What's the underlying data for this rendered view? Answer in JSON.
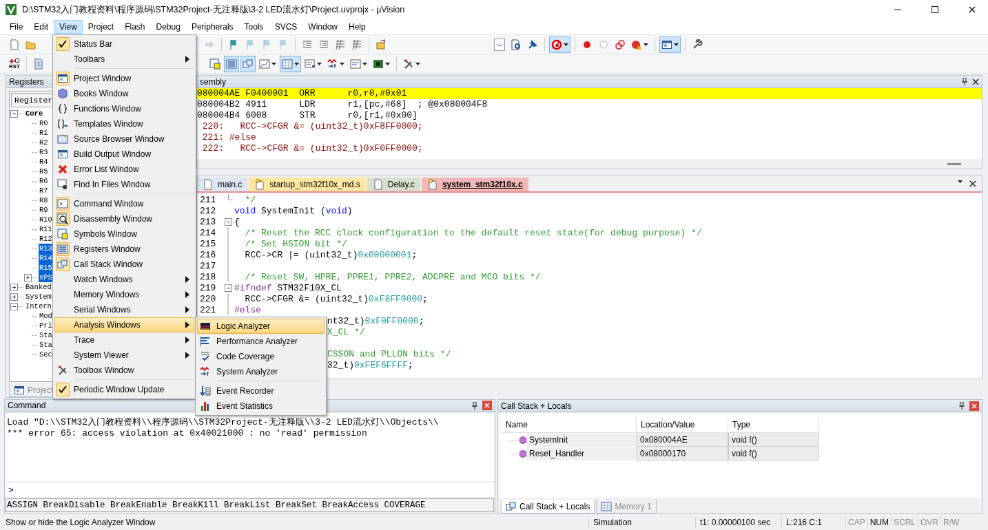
{
  "window": {
    "title": "D:\\STM32入门教程资料\\程序源码\\STM32Project-无注释版\\3-2 LED流水灯\\Project.uvprojx - µVision"
  },
  "menu_bar": [
    {
      "label": "File",
      "selected": false
    },
    {
      "label": "Edit",
      "selected": false
    },
    {
      "label": "View",
      "selected": true
    },
    {
      "label": "Project",
      "selected": false
    },
    {
      "label": "Flash",
      "selected": false
    },
    {
      "label": "Debug",
      "selected": false
    },
    {
      "label": "Peripherals",
      "selected": false
    },
    {
      "label": "Tools",
      "selected": false
    },
    {
      "label": "SVCS",
      "selected": false
    },
    {
      "label": "Window",
      "selected": false
    },
    {
      "label": "Help",
      "selected": false
    }
  ],
  "toolbar_1": {
    "left": [
      {
        "kind": "button",
        "pressed": false,
        "disabled": false,
        "dropdown": false
      },
      {
        "kind": "button",
        "pressed": false,
        "disabled": false,
        "dropdown": false
      }
    ],
    "main": [
      {
        "kind": "button",
        "pressed": false,
        "disabled": true,
        "dropdown": false
      },
      {
        "kind": "separator"
      },
      {
        "kind": "button",
        "pressed": false,
        "disabled": false,
        "dropdown": false
      },
      {
        "kind": "button",
        "pressed": false,
        "disabled": true,
        "dropdown": false
      },
      {
        "kind": "button",
        "pressed": false,
        "disabled": true,
        "dropdown": false
      },
      {
        "kind": "button",
        "pressed": false,
        "disabled": true,
        "dropdown": false
      },
      {
        "kind": "separator"
      },
      {
        "kind": "button",
        "pressed": false,
        "disabled": false,
        "dropdown": false
      },
      {
        "kind": "button",
        "pressed": false,
        "disabled": false,
        "dropdown": false
      },
      {
        "kind": "button",
        "pressed": false,
        "disabled": false,
        "dropdown": false
      },
      {
        "kind": "button",
        "pressed": false,
        "disabled": false,
        "dropdown": false
      },
      {
        "kind": "separator"
      },
      {
        "kind": "button",
        "pressed": false,
        "disabled": false,
        "dropdown": false
      }
    ],
    "right": [
      {
        "kind": "button",
        "pressed": false,
        "disabled": false,
        "dropdown": false
      },
      {
        "kind": "button",
        "pressed": false,
        "disabled": false,
        "dropdown": false
      },
      {
        "kind": "button",
        "pressed": false,
        "disabled": false,
        "dropdown": false
      },
      {
        "kind": "separator"
      },
      {
        "kind": "button",
        "pressed": true,
        "disabled": false,
        "dropdown": true
      },
      {
        "kind": "separator"
      },
      {
        "kind": "button",
        "pressed": false,
        "disabled": false,
        "dropdown": false
      },
      {
        "kind": "button",
        "pressed": false,
        "disabled": false,
        "dropdown": false
      },
      {
        "kind": "button",
        "pressed": false,
        "disabled": false,
        "dropdown": false
      },
      {
        "kind": "button",
        "pressed": false,
        "disabled": false,
        "dropdown": true
      },
      {
        "kind": "separator"
      },
      {
        "kind": "button",
        "pressed": true,
        "disabled": false,
        "dropdown": true
      },
      {
        "kind": "separator"
      },
      {
        "kind": "button",
        "pressed": false,
        "disabled": false,
        "dropdown": false
      }
    ]
  },
  "toolbar_2": {
    "left": [
      {
        "kind": "button",
        "pressed": false,
        "disabled": false,
        "dropdown": false,
        "label": "RST"
      },
      {
        "kind": "separator"
      },
      {
        "kind": "button",
        "pressed": false,
        "disabled": false,
        "dropdown": false
      }
    ],
    "main": [
      {
        "kind": "button",
        "pressed": false,
        "disabled": false,
        "dropdown": false
      },
      {
        "kind": "button",
        "pressed": true,
        "disabled": false,
        "dropdown": false
      },
      {
        "kind": "button",
        "pressed": true,
        "disabled": false,
        "dropdown": false
      },
      {
        "kind": "button",
        "pressed": false,
        "disabled": false,
        "dropdown": true
      },
      {
        "kind": "button",
        "pressed": true,
        "disabled": false,
        "dropdown": true
      },
      {
        "kind": "button",
        "pressed": false,
        "disabled": false,
        "dropdown": true
      },
      {
        "kind": "button",
        "pressed": false,
        "disabled": false,
        "dropdown": true
      },
      {
        "kind": "button",
        "pressed": false,
        "disabled": false,
        "dropdown": true
      },
      {
        "kind": "button",
        "pressed": false,
        "disabled": false,
        "dropdown": true
      },
      {
        "kind": "separator"
      },
      {
        "kind": "button",
        "pressed": false,
        "disabled": false,
        "dropdown": true
      }
    ]
  },
  "registers": {
    "title": "Registers",
    "column": "Register",
    "tree": [
      {
        "label": "Core",
        "expanded": true,
        "selected": false,
        "children": [
          {
            "label": "R0",
            "selected": false
          },
          {
            "label": "R1",
            "selected": false
          },
          {
            "label": "R2",
            "selected": false
          },
          {
            "label": "R3",
            "selected": false
          },
          {
            "label": "R4",
            "selected": false
          },
          {
            "label": "R5",
            "selected": false
          },
          {
            "label": "R6",
            "selected": false
          },
          {
            "label": "R7",
            "selected": false
          },
          {
            "label": "R8",
            "selected": false
          },
          {
            "label": "R9",
            "selected": false
          },
          {
            "label": "R10",
            "selected": false
          },
          {
            "label": "R11",
            "selected": false
          },
          {
            "label": "R12",
            "selected": false
          },
          {
            "label": "R13",
            "selected": true
          },
          {
            "label": "R14",
            "selected": true
          },
          {
            "label": "R15",
            "selected": true
          },
          {
            "label": "xPS",
            "selected": true,
            "expanded": false
          }
        ]
      },
      {
        "label": "Banked",
        "expanded": false,
        "selected": false
      },
      {
        "label": "System",
        "expanded": false,
        "selected": false
      },
      {
        "label": "Intern",
        "expanded": true,
        "selected": false,
        "children": [
          {
            "label": "Mod",
            "selected": false
          },
          {
            "label": "Pri",
            "selected": false
          },
          {
            "label": "Sta",
            "selected": false
          },
          {
            "label": "Sta",
            "selected": false
          },
          {
            "label": "Sec",
            "selected": false
          }
        ]
      }
    ],
    "tabs": [
      {
        "label": "Project",
        "selected": false
      }
    ]
  },
  "disassembly": {
    "title": "sembly",
    "lines": [
      {
        "kind": "asm",
        "text": "080004AE F0400001  ORR      r0,r0,#0x01",
        "current": true
      },
      {
        "kind": "asm",
        "text": "080004B2 4911      LDR      r1,[pc,#68]  ; @0x080004F8",
        "current": false
      },
      {
        "kind": "asm",
        "text": "080004B4 6008      STR      r0,[r1,#0x00]",
        "current": false
      },
      {
        "kind": "src",
        "text": " 220:   RCC->CFGR &= (uint32_t)0xF8FF0000;",
        "current": false
      },
      {
        "kind": "src",
        "text": " 221: #else",
        "current": false
      },
      {
        "kind": "src",
        "text": " 222:   RCC->CFGR &= (uint32_t)0xF0FF0000;",
        "current": false
      }
    ]
  },
  "editor": {
    "tabs": [
      {
        "label": "main.c",
        "kind": "source",
        "color": "#dce6f4",
        "selected": false
      },
      {
        "label": "startup_stm32f10x_md.s",
        "kind": "config",
        "color": "#fbe6a2",
        "selected": false
      },
      {
        "label": "Delay.c",
        "kind": "source",
        "color": "#d7dfcf",
        "selected": false
      },
      {
        "label": "system_stm32f10x.c",
        "kind": "config",
        "color": "#f4b7b7",
        "selected": true
      }
    ],
    "lines": [
      {
        "number": "211",
        "kind": "fold-end",
        "tokens": [
          {
            "kind": "comment",
            "text": "  */"
          }
        ]
      },
      {
        "number": "212",
        "kind": "plain",
        "tokens": [
          {
            "kind": "keyword",
            "text": "void"
          },
          {
            "kind": "plain",
            "text": " SystemInit ("
          },
          {
            "kind": "keyword",
            "text": "void"
          },
          {
            "kind": "plain",
            "text": ")"
          }
        ]
      },
      {
        "number": "213",
        "kind": "fold-start",
        "tokens": [
          {
            "kind": "plain",
            "text": "{"
          }
        ]
      },
      {
        "number": "214",
        "kind": "body",
        "tokens": [
          {
            "kind": "comment",
            "text": "  /* Reset the RCC clock configuration to the default reset state(for debug purpose) */"
          }
        ]
      },
      {
        "number": "215",
        "kind": "body",
        "tokens": [
          {
            "kind": "comment",
            "text": "  /* Set HSION bit */"
          }
        ]
      },
      {
        "number": "216",
        "kind": "body",
        "tokens": [
          {
            "kind": "plain",
            "text": "  RCC->CR |= (uint32_t)"
          },
          {
            "kind": "number",
            "text": "0x00000001"
          },
          {
            "kind": "plain",
            "text": ";"
          }
        ]
      },
      {
        "number": "217",
        "kind": "body"
      },
      {
        "number": "218",
        "kind": "body",
        "tokens": [
          {
            "kind": "comment",
            "text": "  /* Reset SW, HPRE, PPRE1, PPRE2, ADCPRE and MCO bits */"
          }
        ]
      },
      {
        "number": "219",
        "kind": "fold-start",
        "tokens": [
          {
            "kind": "preproc",
            "text": "#ifndef"
          },
          {
            "kind": "plain",
            "text": " STM32F10X_CL"
          }
        ]
      },
      {
        "number": "220",
        "kind": "body",
        "tokens": [
          {
            "kind": "plain",
            "text": "  RCC->CFGR &= (uint32_t)"
          },
          {
            "kind": "number",
            "text": "0xF8FF0000"
          },
          {
            "kind": "plain",
            "text": ";"
          }
        ]
      },
      {
        "number": "221",
        "kind": "body",
        "tokens": [
          {
            "kind": "preproc",
            "text": "#else"
          }
        ]
      },
      {
        "kind": "covered",
        "tokens": [
          {
            "kind": "plain",
            "text": "nt32_t)"
          },
          {
            "kind": "number",
            "text": "0xF0FF0000"
          },
          {
            "kind": "plain",
            "text": ";"
          }
        ]
      },
      {
        "kind": "covered",
        "tokens": [
          {
            "kind": "comment",
            "text": "X_CL */"
          }
        ]
      },
      {
        "kind": "covered"
      },
      {
        "kind": "covered",
        "tokens": [
          {
            "kind": "comment",
            "text": "CSSON and PLLON bits */"
          }
        ]
      },
      {
        "kind": "covered",
        "tokens": [
          {
            "kind": "plain",
            "text": "32_t)"
          },
          {
            "kind": "number",
            "text": "0xFEF6FFFF"
          },
          {
            "kind": "plain",
            "text": ";"
          }
        ]
      }
    ]
  },
  "command": {
    "title": "Command",
    "output": [
      "Load \"D:\\\\STM32入门教程资料\\\\程序源码\\\\STM32Project-无注释版\\\\3-2 LED流水灯\\\\Objects\\\\",
      "*** error 65: access violation at 0x40021000 : no 'read' permission"
    ],
    "prompt": ">",
    "hints": "ASSIGN BreakDisable BreakEnable BreakKill BreakList BreakSet BreakAccess COVERAGE"
  },
  "call_stack": {
    "title": "Call Stack + Locals",
    "columns": [
      "Name",
      "Location/Value",
      "Type"
    ],
    "rows": [
      {
        "name": "SystemInit",
        "location": "0x080004AE",
        "type": "void f()"
      },
      {
        "name": "Reset_Handler",
        "location": "0x08000170",
        "type": "void f()"
      }
    ],
    "tabs": [
      {
        "label": "Call Stack + Locals",
        "selected": true
      },
      {
        "label": "Memory 1",
        "selected": false
      }
    ]
  },
  "view_menu": {
    "items": [
      {
        "kind": "item",
        "label": "Status Bar",
        "checked": true,
        "submenu": false,
        "selected": false
      },
      {
        "kind": "item",
        "label": "Toolbars",
        "checked": false,
        "submenu": true,
        "selected": false
      },
      {
        "kind": "separator"
      },
      {
        "kind": "item",
        "label": "Project Window",
        "checked": true,
        "submenu": false,
        "selected": false
      },
      {
        "kind": "item",
        "label": "Books Window",
        "checked": false,
        "submenu": false,
        "selected": false
      },
      {
        "kind": "item",
        "label": "Functions Window",
        "checked": false,
        "submenu": false,
        "selected": false
      },
      {
        "kind": "item",
        "label": "Templates Window",
        "checked": false,
        "submenu": false,
        "selected": false
      },
      {
        "kind": "item",
        "label": "Source Browser Window",
        "checked": false,
        "submenu": false,
        "selected": false
      },
      {
        "kind": "item",
        "label": "Build Output Window",
        "checked": false,
        "submenu": false,
        "selected": false
      },
      {
        "kind": "item",
        "label": "Error List Window",
        "checked": false,
        "submenu": false,
        "selected": false
      },
      {
        "kind": "item",
        "label": "Find In Files Window",
        "checked": false,
        "submenu": false,
        "selected": false
      },
      {
        "kind": "separator"
      },
      {
        "kind": "item",
        "label": "Command Window",
        "checked": true,
        "submenu": false,
        "selected": false
      },
      {
        "kind": "item",
        "label": "Disassembly Window",
        "checked": true,
        "submenu": false,
        "selected": false
      },
      {
        "kind": "item",
        "label": "Symbols Window",
        "checked": false,
        "submenu": false,
        "selected": false
      },
      {
        "kind": "item",
        "label": "Registers Window",
        "checked": true,
        "submenu": false,
        "selected": false
      },
      {
        "kind": "item",
        "label": "Call Stack Window",
        "checked": true,
        "submenu": false,
        "selected": false
      },
      {
        "kind": "item",
        "label": "Watch Windows",
        "checked": false,
        "submenu": true,
        "selected": false
      },
      {
        "kind": "item",
        "label": "Memory Windows",
        "checked": false,
        "submenu": true,
        "selected": false
      },
      {
        "kind": "item",
        "label": "Serial Windows",
        "checked": false,
        "submenu": true,
        "selected": false
      },
      {
        "kind": "item",
        "label": "Analysis Windows",
        "checked": false,
        "submenu": true,
        "selected": true
      },
      {
        "kind": "item",
        "label": "Trace",
        "checked": false,
        "submenu": true,
        "selected": false
      },
      {
        "kind": "item",
        "label": "System Viewer",
        "checked": false,
        "submenu": true,
        "selected": false
      },
      {
        "kind": "item",
        "label": "Toolbox Window",
        "checked": false,
        "submenu": false,
        "selected": false
      },
      {
        "kind": "separator"
      },
      {
        "kind": "item",
        "label": "Periodic Window Update",
        "checked": true,
        "submenu": false,
        "selected": false
      }
    ]
  },
  "analysis_submenu": {
    "items": [
      {
        "kind": "item",
        "label": "Logic Analyzer",
        "checked": false,
        "submenu": false,
        "selected": true
      },
      {
        "kind": "item",
        "label": "Performance Analyzer",
        "checked": false,
        "submenu": false,
        "selected": false
      },
      {
        "kind": "item",
        "label": "Code Coverage",
        "checked": false,
        "submenu": false,
        "selected": false
      },
      {
        "kind": "item",
        "label": "System Analyzer",
        "checked": false,
        "submenu": false,
        "selected": false
      },
      {
        "kind": "separator"
      },
      {
        "kind": "item",
        "label": "Event Recorder",
        "checked": false,
        "submenu": false,
        "selected": false
      },
      {
        "kind": "item",
        "label": "Event Statistics",
        "checked": false,
        "submenu": false,
        "selected": false
      }
    ]
  },
  "status_bar": {
    "message": "Show or hide the Logic Analyzer Window",
    "mode": "Simulation",
    "time": "t1: 0.00000100 sec",
    "position": "L:216 C:1",
    "indicators": [
      {
        "label": "CAP",
        "on": false
      },
      {
        "label": "NUM",
        "on": true
      },
      {
        "label": "SCRL",
        "on": false
      },
      {
        "label": "OVR",
        "on": false
      },
      {
        "label": "R/W",
        "on": false
      }
    ]
  }
}
